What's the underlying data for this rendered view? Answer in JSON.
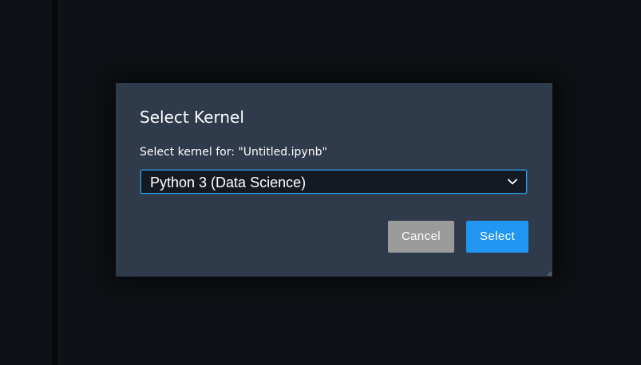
{
  "dialog": {
    "title": "Select Kernel",
    "label": "Select kernel for: \"Untitled.ipynb\"",
    "kernel_select": {
      "selected": "Python 3 (Data Science)"
    },
    "cancel_label": "Cancel",
    "select_label": "Select"
  },
  "icons": {
    "chevron": "chevron-down-icon",
    "resize": "resize-handle-icon"
  },
  "colors": {
    "dialog_bg": "#2f3a4b",
    "page_bg": "#0f1116",
    "select_border": "#2b9fe3",
    "primary_button": "#2196f3",
    "cancel_button": "#9b9b9b"
  }
}
